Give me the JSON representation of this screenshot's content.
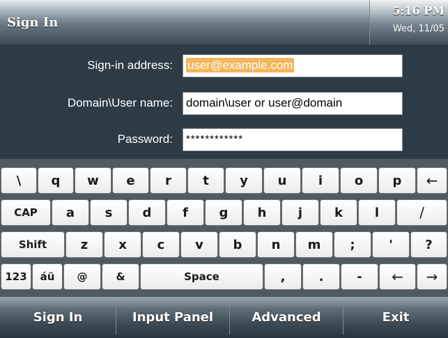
{
  "header": {
    "title": "Sign In",
    "time": "5:16 PM",
    "date": "Wed, 11/05"
  },
  "form": {
    "signin_label": "Sign-in address:",
    "signin_value": "user@example.com",
    "domain_label": "Domain\\User name:",
    "domain_value": "domain\\user or user@domain",
    "password_label": "Password:",
    "password_value": "************"
  },
  "keyboard": {
    "row1": [
      "\\",
      "q",
      "w",
      "e",
      "r",
      "t",
      "y",
      "u",
      "i",
      "o",
      "p",
      "←"
    ],
    "row2": [
      "CAP",
      "a",
      "s",
      "d",
      "f",
      "g",
      "h",
      "j",
      "k",
      "l",
      "/"
    ],
    "row3": [
      "Shift",
      "z",
      "x",
      "c",
      "v",
      "b",
      "n",
      "m",
      ";",
      "'",
      "?"
    ],
    "row4": [
      "123",
      "áü",
      "@",
      "&",
      "Space",
      ",",
      ".",
      "-",
      "←",
      "→"
    ]
  },
  "bottom_bar": {
    "sign_in": "Sign In",
    "input_panel": "Input Panel",
    "advanced": "Advanced",
    "exit": "Exit"
  }
}
